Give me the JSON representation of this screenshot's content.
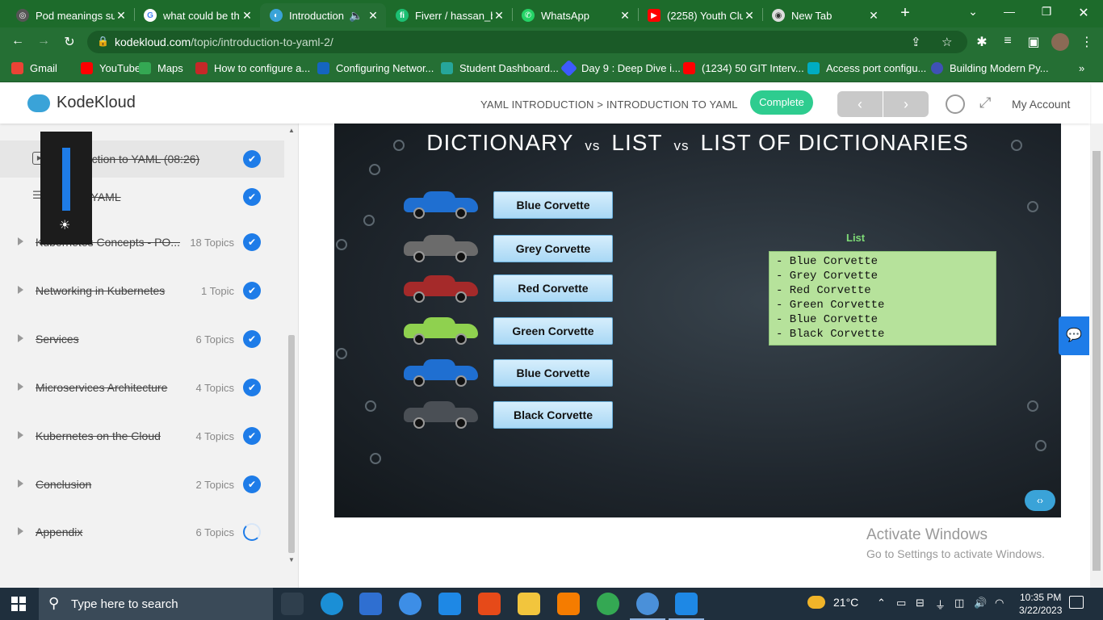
{
  "browser": {
    "tabs": [
      {
        "title": "Pod meanings su",
        "fav_color": "#555555",
        "fav_glyph": "◎"
      },
      {
        "title": "what could be th",
        "fav_color": "#ffffff",
        "fav_glyph": "G"
      },
      {
        "title": "Introduction",
        "fav_color": "#3aa3d8",
        "fav_glyph": "◐",
        "active": true
      },
      {
        "title": "Fiverr / hassan_b",
        "fav_color": "#1dbf73",
        "fav_glyph": "fi"
      },
      {
        "title": "WhatsApp",
        "fav_color": "#25d366",
        "fav_glyph": "✆"
      },
      {
        "title": "(2258) Youth Clul",
        "fav_color": "#ff0000",
        "fav_glyph": "▶"
      },
      {
        "title": "New Tab",
        "fav_color": "#dddddd",
        "fav_glyph": "◉"
      }
    ],
    "url_host": "kodekloud.com",
    "url_path": "/topic/introduction-to-yaml-2/",
    "bookmarks": [
      {
        "label": "Gmail",
        "color": "#ea4335"
      },
      {
        "label": "YouTube",
        "color": "#ff0000"
      },
      {
        "label": "Maps",
        "color": "#34a853"
      },
      {
        "label": "How to configure a...",
        "color": "#c62828"
      },
      {
        "label": "Configuring Networ...",
        "color": "#1565c0"
      },
      {
        "label": "Student Dashboard...",
        "color": "#26a69a"
      },
      {
        "label": "Day 9 : Deep Dive i...",
        "color": "#3d5afe"
      },
      {
        "label": "(1234) 50 GIT Interv...",
        "color": "#ff0000"
      },
      {
        "label": "Access port configu...",
        "color": "#00acc1"
      },
      {
        "label": "Building Modern Py...",
        "color": "#3f51b5"
      }
    ]
  },
  "header": {
    "logo_text": "KodeKloud",
    "breadcrumb": "YAML INTRODUCTION > INTRODUCTION TO YAML",
    "complete_label": "Complete",
    "prev_label": "‹",
    "next_label": "›",
    "account_label": "My Account"
  },
  "sidebar": {
    "lessons": [
      {
        "title": "Introduction to YAML (08:26)",
        "icon": "▶",
        "done": true
      },
      {
        "title": "Labs - YAML",
        "icon": "☰",
        "done": true
      }
    ],
    "modules": [
      {
        "title": "Kubernetes Concepts - PO...",
        "count": "18 Topics",
        "status": "done"
      },
      {
        "title": "Networking in Kubernetes",
        "count": "1 Topic",
        "status": "done"
      },
      {
        "title": "Services",
        "count": "6 Topics",
        "status": "done"
      },
      {
        "title": "Microservices Architecture",
        "count": "4 Topics",
        "status": "done"
      },
      {
        "title": "Kubernetes on the Cloud",
        "count": "4 Topics",
        "status": "done"
      },
      {
        "title": "Conclusion",
        "count": "2 Topics",
        "status": "done"
      },
      {
        "title": "Appendix",
        "count": "6 Topics",
        "status": "in-progress"
      }
    ]
  },
  "brightness": {
    "level_percent": 100
  },
  "slide": {
    "title_a": "DICTIONARY",
    "vs1": "vs",
    "title_b": "LIST",
    "vs2": "vs",
    "title_c": "LIST OF DICTIONARIES",
    "cars": [
      {
        "label": "Blue Corvette",
        "color": "#1f6fd1"
      },
      {
        "label": "Grey Corvette",
        "color": "#6b6b6b"
      },
      {
        "label": "Red Corvette",
        "color": "#a52a2a"
      },
      {
        "label": "Green Corvette",
        "color": "#8fd14f"
      },
      {
        "label": "Blue Corvette",
        "color": "#1f6fd1"
      },
      {
        "label": "Black Corvette",
        "color": "#4a4f55"
      }
    ],
    "list_label": "List",
    "list_items": [
      "-  Blue Corvette",
      "-  Grey Corvette",
      "-  Red Corvette",
      "-  Green Corvette",
      "-  Blue Corvette",
      "-  Black Corvette"
    ]
  },
  "watermark": {
    "line1": "Activate Windows",
    "line2": "Go to Settings to activate Windows."
  },
  "taskbar": {
    "search_placeholder": "Type here to search",
    "temperature": "21°C",
    "time": "10:35 PM",
    "date": "3/22/2023",
    "apps": [
      {
        "name": "task-view-icon",
        "color": "#2f3f4d"
      },
      {
        "name": "edge-icon",
        "color": "#1b8fd6"
      },
      {
        "name": "store-icon",
        "color": "#2f6fd1"
      },
      {
        "name": "skype-icon",
        "color": "#3d8ee6"
      },
      {
        "name": "mail-icon",
        "color": "#1e88e5"
      },
      {
        "name": "app-swirl-icon",
        "color": "#e64a19"
      },
      {
        "name": "file-explorer-icon",
        "color": "#f2c53d"
      },
      {
        "name": "app-gear-icon",
        "color": "#f57c00"
      },
      {
        "name": "chrome-icon",
        "color": "#34a853"
      },
      {
        "name": "chrome-profile-icon",
        "color": "#4a90d9"
      },
      {
        "name": "vscode-icon",
        "color": "#1e88e5"
      }
    ]
  }
}
